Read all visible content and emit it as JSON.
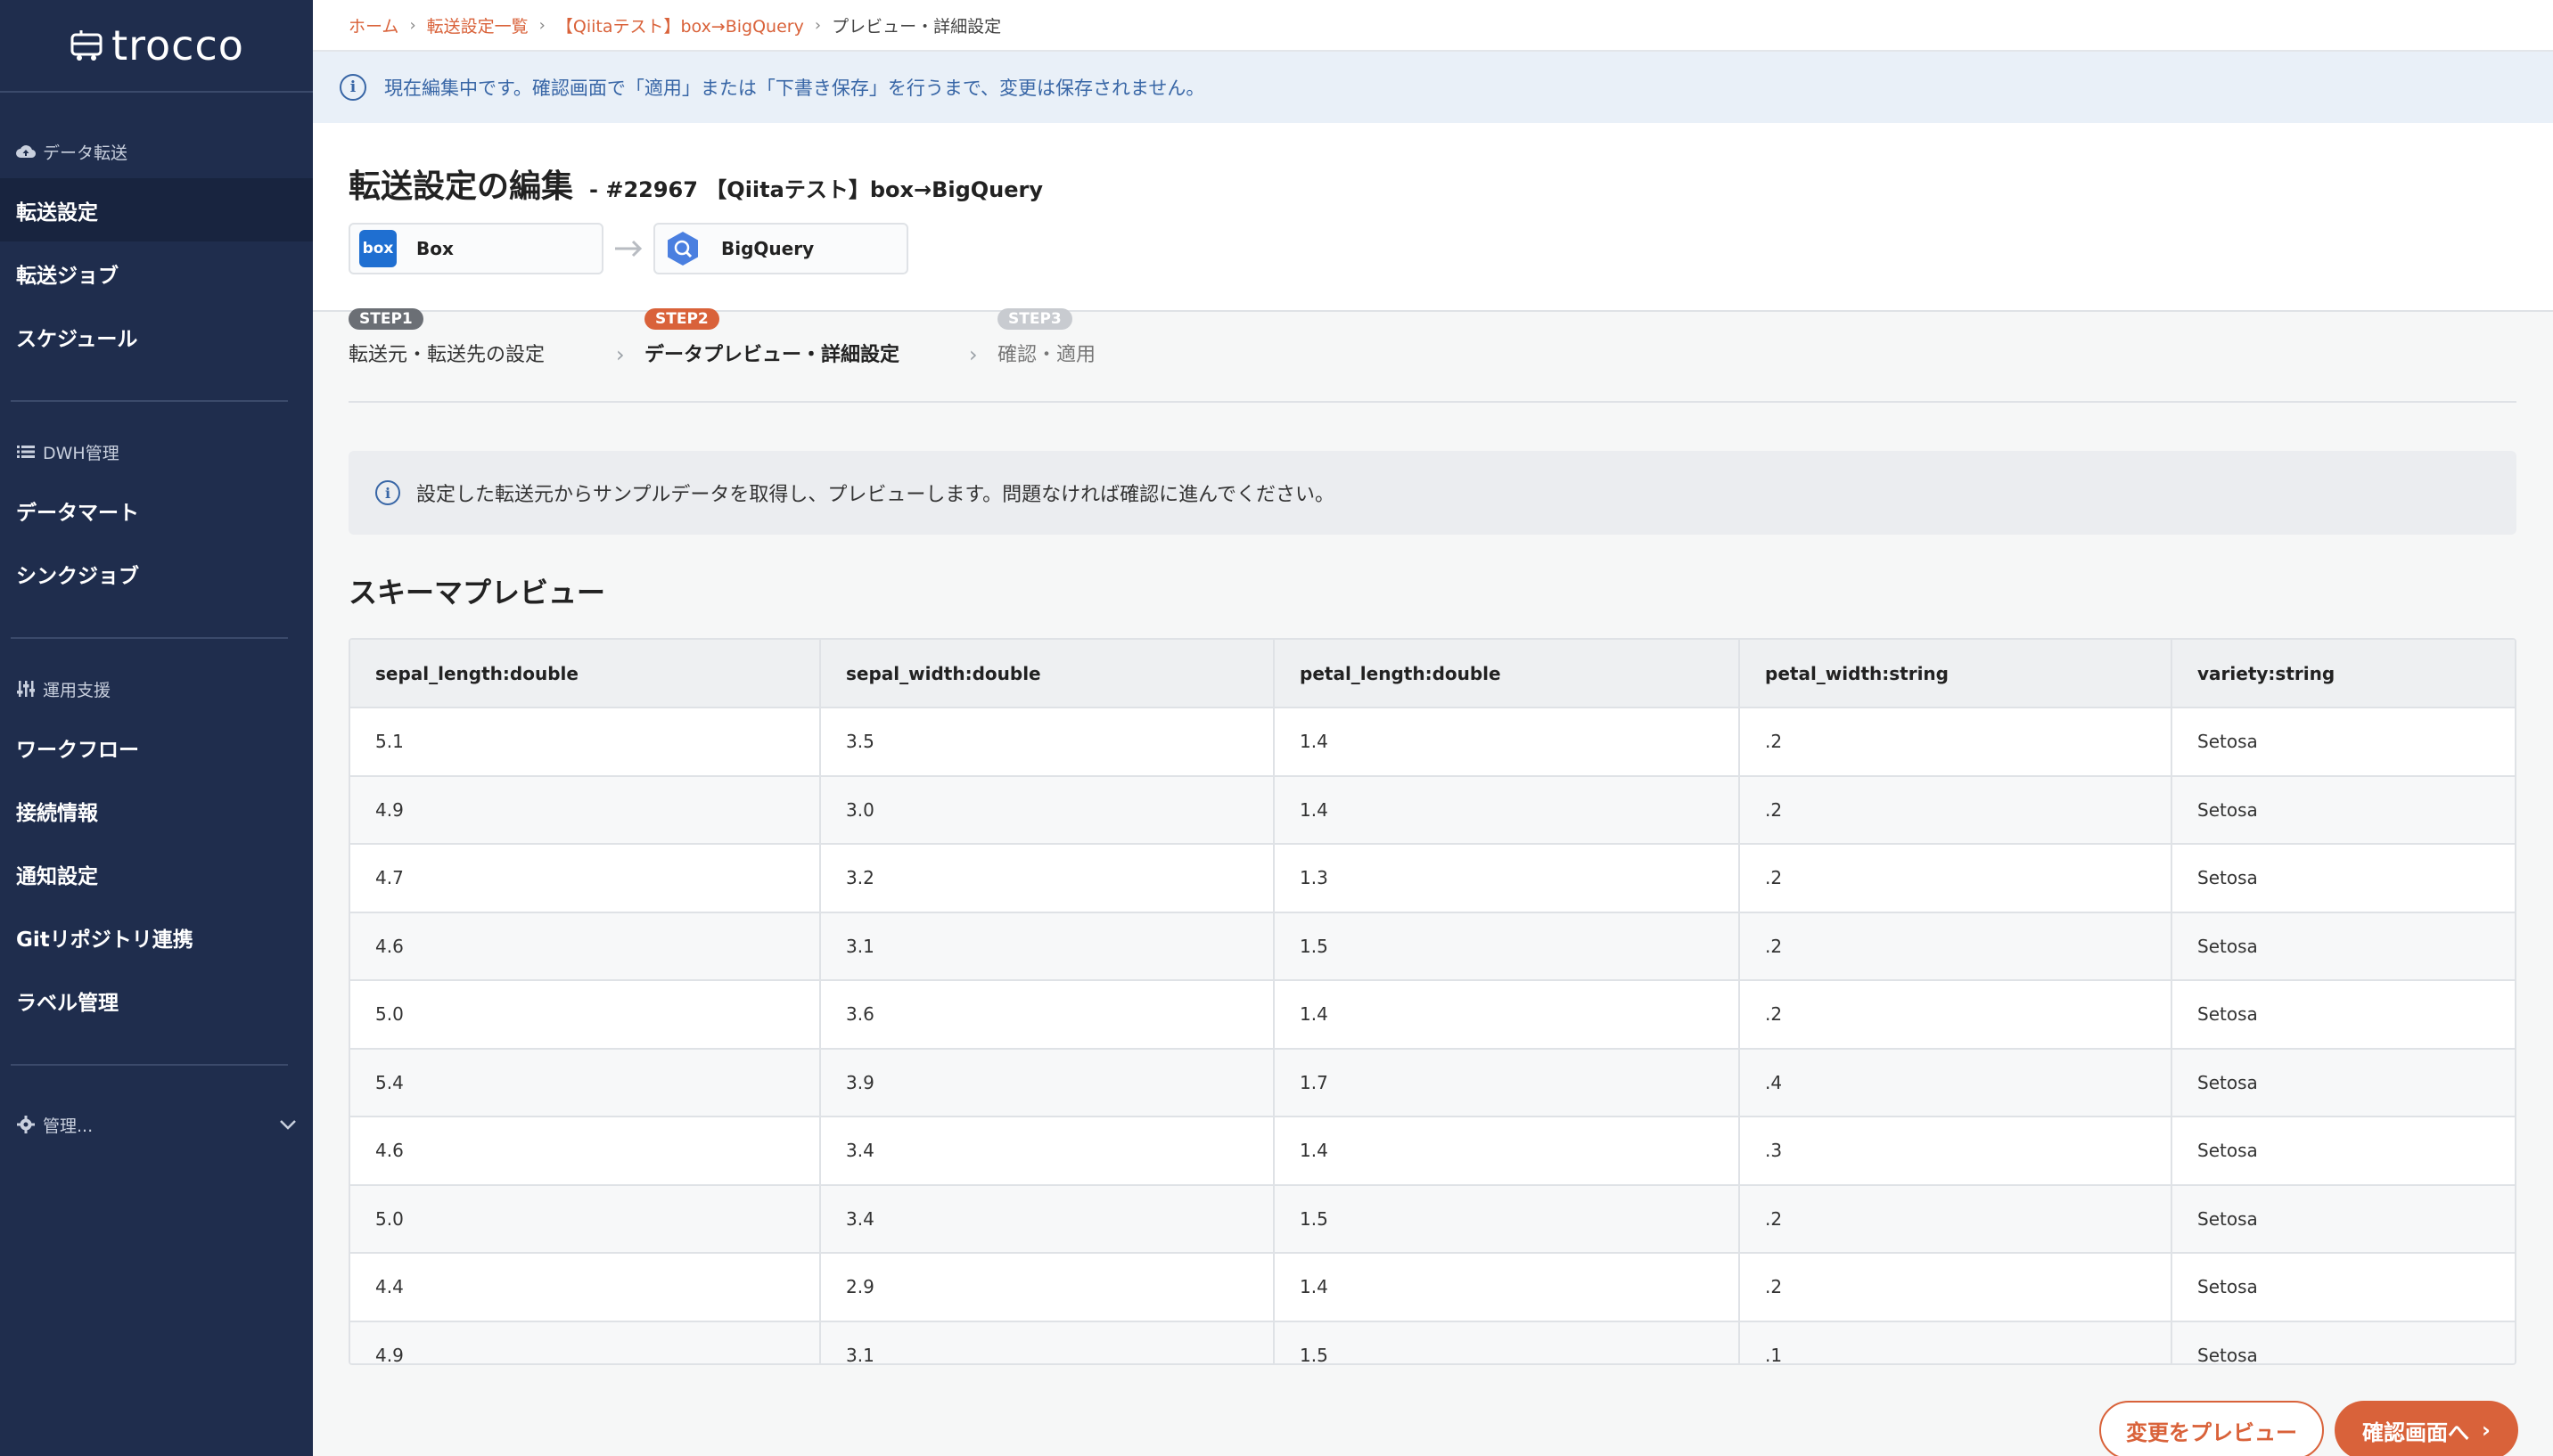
{
  "sidebar": {
    "logo": "trocco",
    "groups": [
      {
        "title": "データ転送",
        "items": [
          "転送設定",
          "転送ジョブ",
          "スケジュール"
        ]
      },
      {
        "title": "DWH管理",
        "items": [
          "データマート",
          "シンクジョブ"
        ]
      },
      {
        "title": "運用支援",
        "items": [
          "ワークフロー",
          "接続情報",
          "通知設定",
          "Gitリポジトリ連携",
          "ラベル管理"
        ]
      }
    ],
    "admin_label": "管理..."
  },
  "breadcrumb": [
    "ホーム",
    "転送設定一覧",
    "【Qiitaテスト】box→BigQuery",
    "プレビュー・詳細設定"
  ],
  "notice": "現在編集中です。確認画面で「適用」または「下書き保存」を行うまで、変更は保存されません。",
  "header": {
    "title": "転送設定の編集",
    "subtitle": "- #22967 【Qiitaテスト】box→BigQuery",
    "source": {
      "label": "Box",
      "icon_text": "box"
    },
    "destination": {
      "label": "BigQuery"
    }
  },
  "steps": [
    {
      "badge": "STEP1",
      "label": "転送元・転送先の設定",
      "color": "#6b6f75"
    },
    {
      "badge": "STEP2",
      "label": "データプレビュー・詳細設定",
      "color": "#d9623a"
    },
    {
      "badge": "STEP3",
      "label": "確認・適用",
      "color": "#c8cbd0"
    }
  ],
  "info": "設定した転送元からサンプルデータを取得し、プレビューします。問題なければ確認に進んでください。",
  "section_title": "スキーマプレビュー",
  "table": {
    "columns": [
      "sepal_length:double",
      "sepal_width:double",
      "petal_length:double",
      "petal_width:string",
      "variety:string"
    ],
    "rows": [
      [
        "5.1",
        "3.5",
        "1.4",
        ".2",
        "Setosa"
      ],
      [
        "4.9",
        "3.0",
        "1.4",
        ".2",
        "Setosa"
      ],
      [
        "4.7",
        "3.2",
        "1.3",
        ".2",
        "Setosa"
      ],
      [
        "4.6",
        "3.1",
        "1.5",
        ".2",
        "Setosa"
      ],
      [
        "5.0",
        "3.6",
        "1.4",
        ".2",
        "Setosa"
      ],
      [
        "5.4",
        "3.9",
        "1.7",
        ".4",
        "Setosa"
      ],
      [
        "4.6",
        "3.4",
        "1.4",
        ".3",
        "Setosa"
      ],
      [
        "5.0",
        "3.4",
        "1.5",
        ".2",
        "Setosa"
      ],
      [
        "4.4",
        "2.9",
        "1.4",
        ".2",
        "Setosa"
      ],
      [
        "4.9",
        "3.1",
        "1.5",
        ".1",
        "Setosa"
      ]
    ]
  },
  "buttons": {
    "preview": "変更をプレビュー",
    "confirm": "確認画面へ"
  },
  "colors": {
    "accent": "#d9623a",
    "sidebar": "#1f2d4d",
    "notice_text": "#3866a6"
  }
}
